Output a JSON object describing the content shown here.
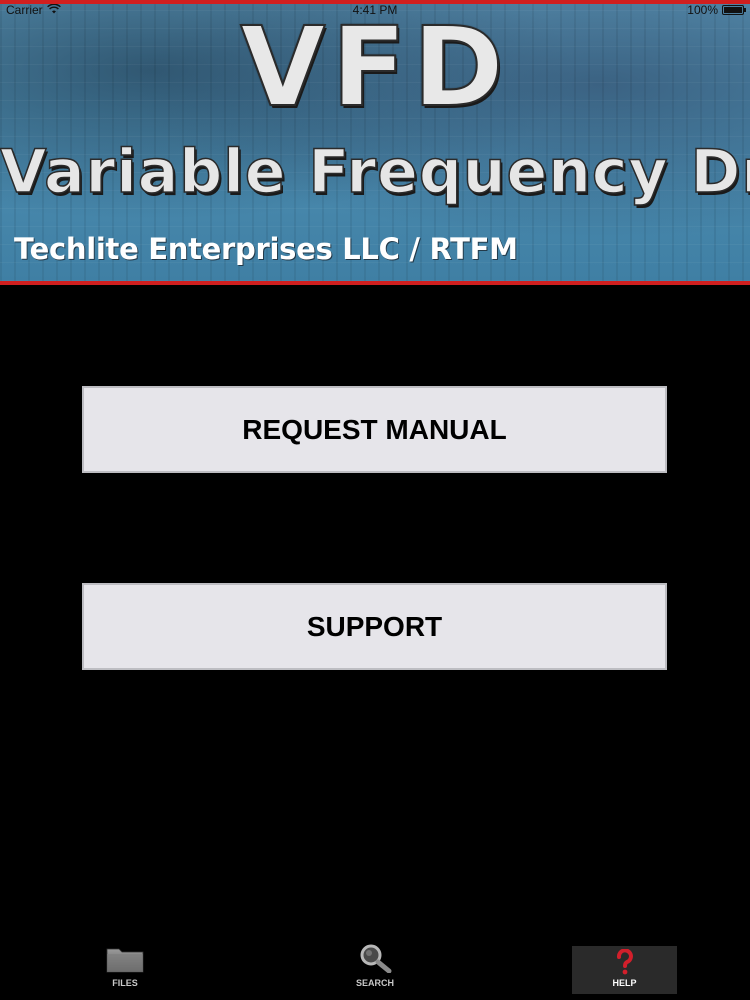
{
  "status_bar": {
    "carrier": "Carrier",
    "time": "4:41 PM",
    "battery": "100%"
  },
  "banner": {
    "title": "VFD",
    "subtitle": "Variable Frequency Drive",
    "company": "Techlite Enterprises LLC / RTFM"
  },
  "buttons": {
    "request_manual": "REQUEST MANUAL",
    "support": "SUPPORT"
  },
  "tab_bar": {
    "tabs": [
      {
        "label": "FILES",
        "icon": "folder-icon",
        "selected": false
      },
      {
        "label": "SEARCH",
        "icon": "magnifier-icon",
        "selected": false
      },
      {
        "label": "HELP",
        "icon": "question-mark-icon",
        "selected": true
      }
    ]
  },
  "colors": {
    "background": "#000000",
    "button_bg": "#e6e5ea",
    "banner_accent": "#d01f1f",
    "help_icon": "#d21f2b"
  }
}
